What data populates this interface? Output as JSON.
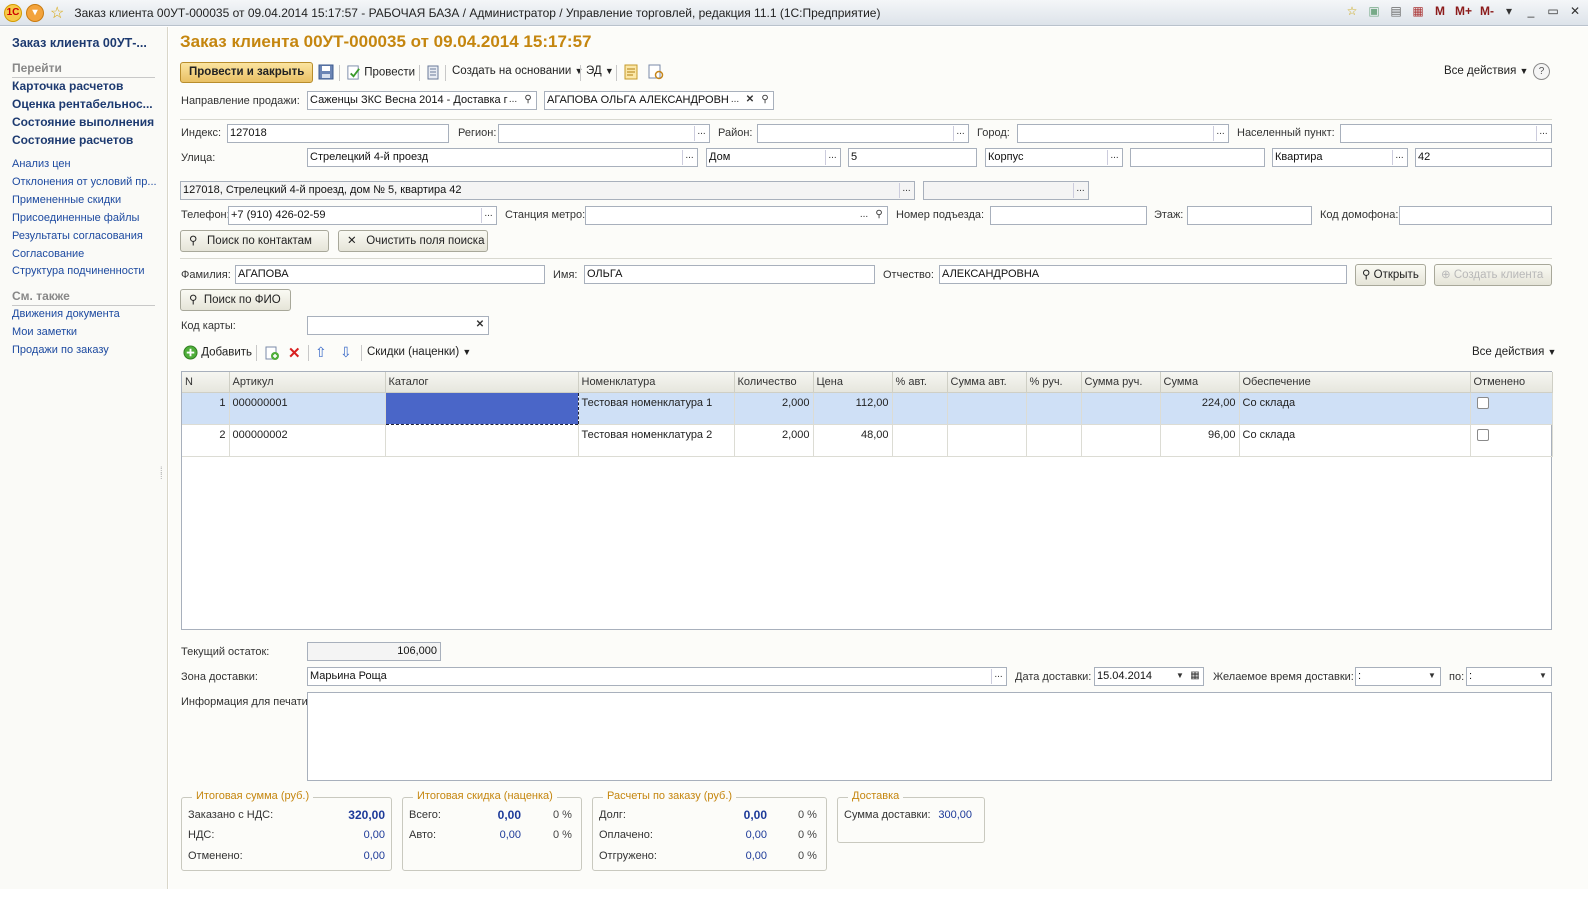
{
  "window": {
    "logo": "1С",
    "title": "Заказ клиента 00УТ-000035 от 09.04.2014 15:17:57 - РАБОЧАЯ БАЗА / Администратор / Управление торговлей, редакция 11.1  (1С:Предприятие)",
    "m_label": "M",
    "mplus_label": "M+",
    "mminus_label": "M-",
    "min_label": "_",
    "restore_label": "▭",
    "close_label": "✕"
  },
  "sidebar": {
    "title": "Заказ клиента 00УТ-...",
    "go_section": "Перейти",
    "main_links": [
      "Карточка расчетов",
      "Оценка рентабельнос...",
      "Состояние выполнения",
      "Состояние расчетов"
    ],
    "links": [
      "Анализ цен",
      "Отклонения от условий пр...",
      "Примененные скидки",
      "Присоединенные файлы",
      "Результаты согласования",
      "Согласование",
      "Структура подчиненности"
    ],
    "see_also_section": "См. также",
    "see_also_links": [
      "Движения документа",
      "Мои заметки",
      "Продажи по заказу"
    ]
  },
  "document": {
    "title": "Заказ клиента 00УТ-000035 от 09.04.2014 15:17:57"
  },
  "toolbar": {
    "post_close": "Провести и закрыть",
    "post": "Провести",
    "create_based": "Создать на основании",
    "ed": "ЭД",
    "all_actions": "Все действия",
    "help": "?"
  },
  "form": {
    "sales_direction_label": "Направление продажи:",
    "sales_direction_value": "Саженцы ЗКС Весна 2014 - Доставка г",
    "client_value": "АГАПОВА ОЛЬГА АЛЕКСАНДРОВН",
    "index_label": "Индекс:",
    "index_value": "127018",
    "region_label": "Регион:",
    "district_label": "Район:",
    "city_label": "Город:",
    "locality_label": "Населенный пункт:",
    "street_label": "Улица:",
    "street_value": "Стрелецкий 4-й проезд",
    "house_type": "Дом",
    "house_value": "5",
    "korpus_type": "Корпус",
    "apt_type": "Квартира",
    "apt_value": "42",
    "address_full": "127018, Стрелецкий 4-й проезд, дом № 5, квартира 42",
    "phone_label": "Телефон:",
    "phone_value": "+7 (910) 426-02-59",
    "metro_label": "Станция метро:",
    "entrance_label": "Номер подъезда:",
    "floor_label": "Этаж:",
    "intercom_label": "Код домофона:",
    "search_contacts": "Поиск по контактам",
    "clear_search": "Очистить поля поиска",
    "surname_label": "Фамилия:",
    "surname_value": "АГАПОВА",
    "name_label": "Имя:",
    "name_value": "ОЛЬГА",
    "patronymic_label": "Отчество:",
    "patronymic_value": "АЛЕКСАНДРОВНА",
    "open_button": "Открыть",
    "create_client_button": "Создать клиента",
    "search_fio": "Поиск по ФИО",
    "card_code_label": "Код карты:"
  },
  "table_toolbar": {
    "add": "Добавить",
    "discounts": "Скидки (наценки)",
    "all_actions": "Все действия"
  },
  "table": {
    "columns": [
      "N",
      "Артикул",
      "Каталог",
      "Номенклатура",
      "Количество",
      "Цена",
      "% авт.",
      "Сумма авт.",
      "% руч.",
      "Сумма руч.",
      "Сумма",
      "Обеспечение",
      "Отменено"
    ],
    "rows": [
      {
        "n": "1",
        "article": "000000001",
        "catalog": "",
        "item": "Тестовая номенклатура 1",
        "qty": "2,000",
        "price": "112,00",
        "pct_auto": "",
        "sum_auto": "",
        "pct_manual": "",
        "sum_manual": "",
        "sum": "224,00",
        "supply": "Со склада",
        "cancelled": false
      },
      {
        "n": "2",
        "article": "000000002",
        "catalog": "",
        "item": "Тестовая номенклатура 2",
        "qty": "2,000",
        "price": "48,00",
        "pct_auto": "",
        "sum_auto": "",
        "pct_manual": "",
        "sum_manual": "",
        "sum": "96,00",
        "supply": "Со склада",
        "cancelled": false
      }
    ]
  },
  "bottom": {
    "balance_label": "Текущий остаток:",
    "balance_value": "106,000",
    "zone_label": "Зона доставки:",
    "zone_value": "Марьина Роща",
    "date_label": "Дата доставки:",
    "date_value": "15.04.2014",
    "time_label": "Желаемое время доставки:",
    "time_from": " :",
    "to_label": "по:",
    "time_to": " :",
    "print_info_label": "Информация для печати:"
  },
  "totals": {
    "sum_caption": "Итоговая сумма (руб.)",
    "ordered_label": "Заказано с НДС:",
    "ordered_value": "320,00",
    "vat_label": "НДС:",
    "vat_value": "0,00",
    "cancelled_label": "Отменено:",
    "cancelled_value": "0,00",
    "discount_caption": "Итоговая скидка (наценка)",
    "total_label": "Всего:",
    "total_value": "0,00",
    "total_pct": "0 %",
    "auto_label": "Авто:",
    "auto_value": "0,00",
    "auto_pct": "0 %",
    "settle_caption": "Расчеты по заказу (руб.)",
    "debt_label": "Долг:",
    "debt_value": "0,00",
    "debt_pct": "0 %",
    "paid_label": "Оплачено:",
    "paid_value": "0,00",
    "paid_pct": "0 %",
    "shipped_label": "Отгружено:",
    "shipped_value": "0,00",
    "shipped_pct": "0 %",
    "delivery_caption": "Доставка",
    "delivery_label": "Сумма доставки:",
    "delivery_value": "300,00"
  }
}
